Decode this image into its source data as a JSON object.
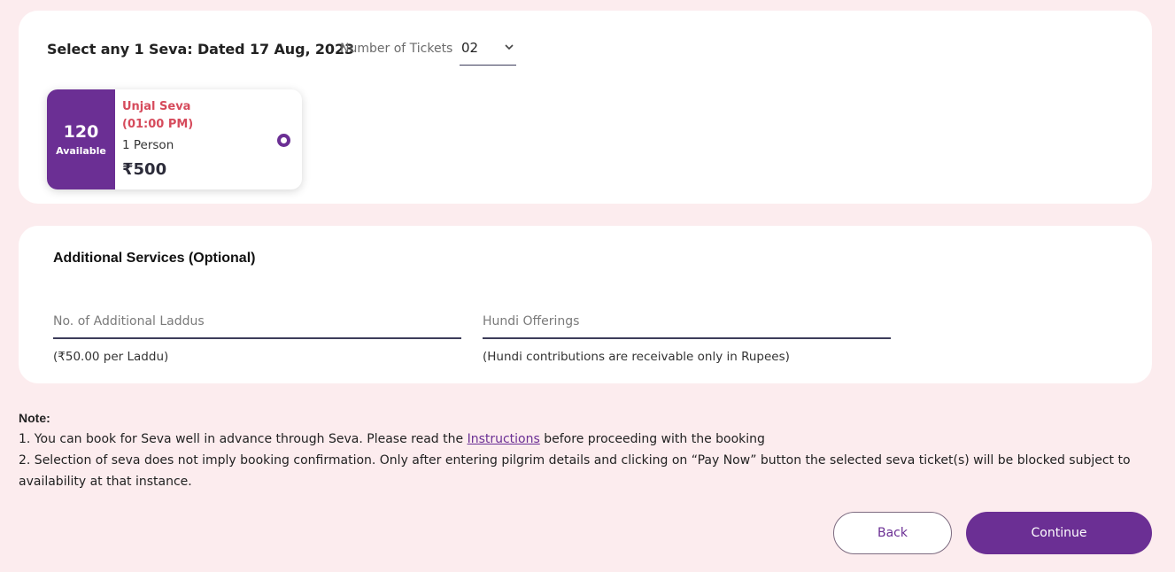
{
  "seva_section": {
    "title": "Select any 1 Seva: Dated 17 Aug, 2023",
    "tickets_label": "Number of Tickets",
    "tickets_value": "02",
    "option": {
      "available_count": "120",
      "available_label": "Available",
      "name": "Unjal Seva",
      "time": "(01:00 PM)",
      "persons": "1 Person",
      "price": "₹500",
      "selected": true
    }
  },
  "services_section": {
    "title": "Additional Services (Optional)",
    "laddu": {
      "placeholder": "No. of Additional Laddus",
      "value": "",
      "hint": "(₹50.00 per Laddu)"
    },
    "hundi": {
      "placeholder": "Hundi Offerings",
      "value": "",
      "hint": "(Hundi contributions are receivable only in Rupees)"
    }
  },
  "note": {
    "heading": "Note:",
    "line1_pre": "1. You can book for Seva well in advance through Seva. Please read the ",
    "line1_link": "Instructions",
    "line1_post": " before proceeding with the booking",
    "line2": "2. Selection of seva does not imply booking confirmation. Only after entering pilgrim details and clicking on “Pay Now” button the selected seva ticket(s) will be blocked subject to availability at that instance."
  },
  "actions": {
    "back_label": "Back",
    "continue_label": "Continue"
  },
  "icons": {
    "tickets_dropdown": "chevron-down-icon",
    "seva_selector": "radio-selected-icon"
  },
  "colors": {
    "page_background": "#fcecee",
    "brand_purple": "#6b2f94",
    "seva_name_red": "#d64b5c"
  }
}
